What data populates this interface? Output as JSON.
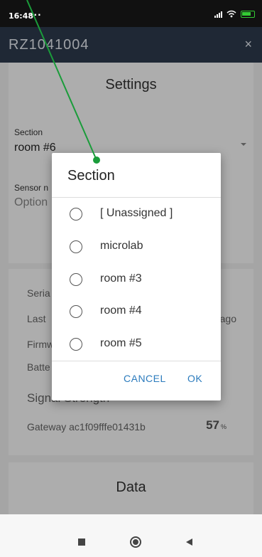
{
  "status_bar": {
    "time": "16:48",
    "dots": "···"
  },
  "header": {
    "title": "RZ1041004",
    "close_glyph": "×"
  },
  "settings": {
    "title": "Settings",
    "section_label": "Section",
    "section_value": "room #6",
    "sensor_label": "Sensor n",
    "sensor_placeholder": "Option"
  },
  "info": {
    "rows": [
      "Seria",
      "Last",
      "Firmw",
      "Batte"
    ],
    "last_right": "ago",
    "signal_title": "Signal Strength",
    "gateway_label": "Gateway ac1f09fffe01431b",
    "gateway_value": "57",
    "gateway_unit": "%"
  },
  "data_card": {
    "title": "Data"
  },
  "dialog": {
    "title": "Section",
    "options": [
      "[ Unassigned ]",
      "microlab",
      "room #3",
      "room #4",
      "room #5"
    ],
    "cancel": "CANCEL",
    "ok": "OK"
  },
  "colors": {
    "header": "#2f3c4e",
    "accent": "#2b7bbd",
    "annotation": "#1a9c3a"
  },
  "icons": {
    "close": "close-icon",
    "nav_recents": "recents-square-icon",
    "nav_home": "home-circle-icon",
    "nav_back": "back-triangle-icon"
  }
}
